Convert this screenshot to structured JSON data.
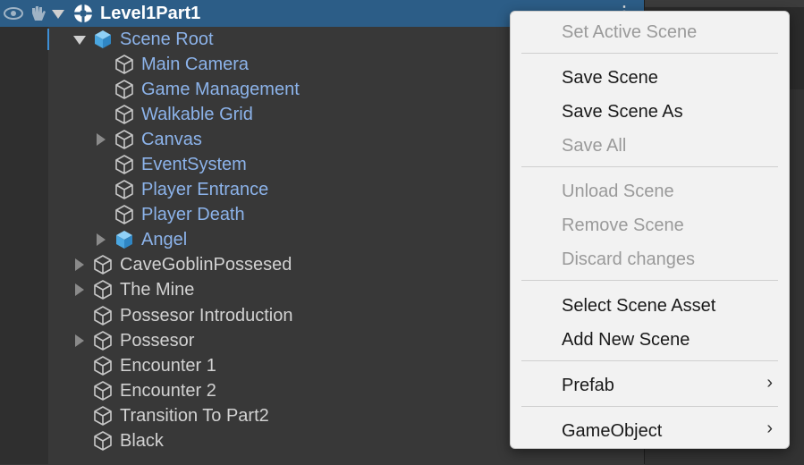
{
  "hierarchy": {
    "scene": "Level1Part1",
    "items": [
      {
        "label": "Scene Root",
        "prefab": true
      },
      {
        "label": "Main Camera",
        "prefab": true
      },
      {
        "label": "Game Management",
        "prefab": true
      },
      {
        "label": "Walkable Grid",
        "prefab": true
      },
      {
        "label": "Canvas",
        "prefab": true
      },
      {
        "label": "EventSystem",
        "prefab": true
      },
      {
        "label": "Player Entrance",
        "prefab": true
      },
      {
        "label": "Player Death",
        "prefab": true
      },
      {
        "label": "Angel",
        "prefab": true
      },
      {
        "label": "CaveGoblinPossesed",
        "prefab": false
      },
      {
        "label": "The Mine",
        "prefab": false
      },
      {
        "label": "Possesor Introduction",
        "prefab": false
      },
      {
        "label": "Possesor",
        "prefab": false
      },
      {
        "label": "Encounter 1",
        "prefab": false
      },
      {
        "label": "Encounter 2",
        "prefab": false
      },
      {
        "label": "Transition To Part2",
        "prefab": false
      },
      {
        "label": "Black",
        "prefab": false
      }
    ]
  },
  "context_menu": {
    "items": [
      {
        "label": "Set Active Scene",
        "disabled": true
      },
      {
        "label": "Save Scene",
        "disabled": false
      },
      {
        "label": "Save Scene As",
        "disabled": false
      },
      {
        "label": "Save All",
        "disabled": true
      },
      {
        "label": "Unload Scene",
        "disabled": true
      },
      {
        "label": "Remove Scene",
        "disabled": true
      },
      {
        "label": "Discard changes",
        "disabled": true
      },
      {
        "label": "Select Scene Asset",
        "disabled": false
      },
      {
        "label": "Add New Scene",
        "disabled": false
      },
      {
        "label": "Prefab",
        "disabled": false,
        "submenu": true
      },
      {
        "label": "GameObject",
        "disabled": false,
        "submenu": true
      }
    ],
    "submenu_glyph": "›"
  },
  "colors": {
    "selection": "#2c5d87",
    "prefab_text": "#8cb3ea",
    "prefab_icon": "#5fb4ec"
  }
}
